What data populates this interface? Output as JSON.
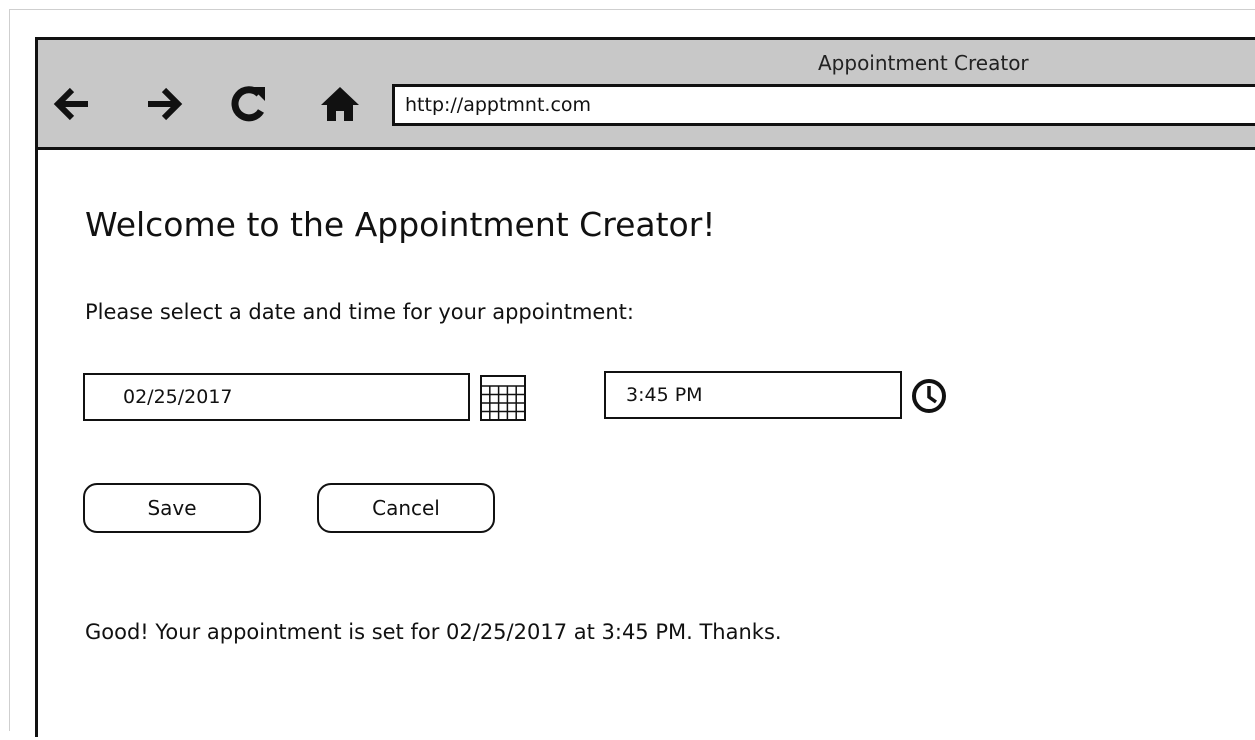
{
  "window": {
    "title": "Appointment Creator"
  },
  "toolbar": {
    "back_icon": "arrow-left-icon",
    "forward_icon": "arrow-right-icon",
    "reload_icon": "reload-icon",
    "home_icon": "home-icon",
    "address": "http://apptmnt.com"
  },
  "page": {
    "title": "Welcome to the Appointment Creator!",
    "instructions": "Please select a date and time for your appointment:",
    "date_value": "02/25/2017",
    "calendar_icon": "calendar-icon",
    "time_value": "3:45 PM",
    "clock_icon": "clock-icon",
    "save_label": "Save",
    "cancel_label": "Cancel",
    "confirmation": "Good! Your appointment is set for 02/25/2017 at 3:45 PM. Thanks."
  },
  "colors": {
    "chrome_background": "#c8c8c8",
    "border": "#111111",
    "page_background": "#ffffff"
  }
}
